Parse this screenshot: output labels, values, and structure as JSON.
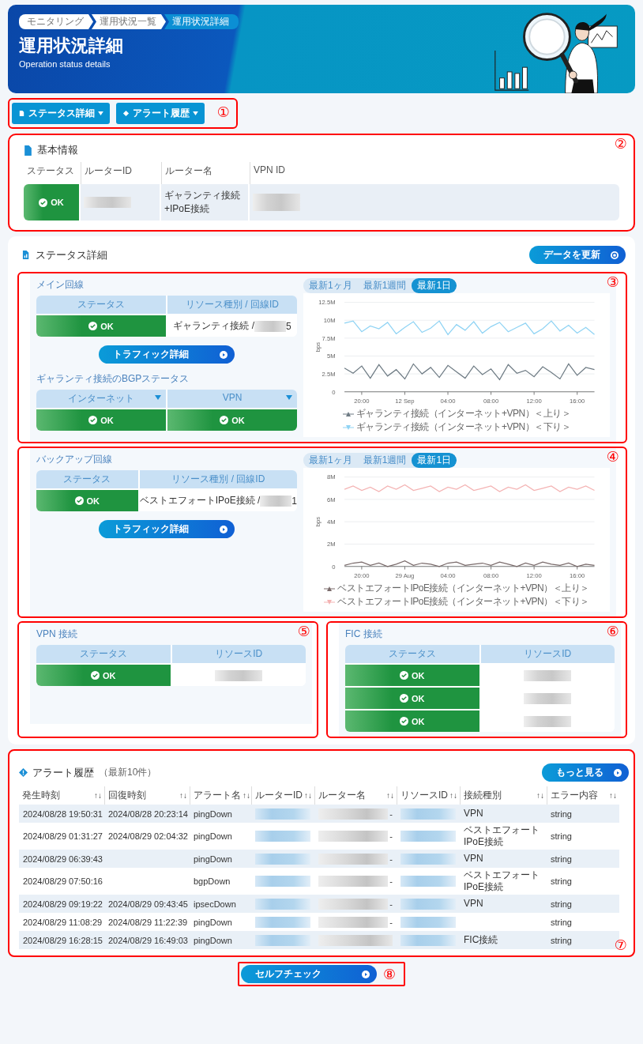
{
  "breadcrumb": [
    {
      "label": "モニタリング",
      "selected": false
    },
    {
      "label": "運用状況一覧",
      "selected": false
    },
    {
      "label": "運用状況詳細",
      "selected": true
    }
  ],
  "title": "運用状況詳細",
  "subtitle": "Operation status details",
  "nav": {
    "marker": "①",
    "buttons": [
      "ステータス詳細",
      "アラート履歴"
    ]
  },
  "basic_info": {
    "marker": "②",
    "title": "基本情報",
    "columns": [
      "ステータス",
      "ルーターID",
      "ルーター名",
      "VPN ID"
    ],
    "status": "OK",
    "router_name": "ギャランティ接続\n+IPoE接続"
  },
  "status_detail": {
    "title": "ステータス詳細",
    "refresh_button": "データを更新",
    "lines": [
      {
        "marker": "③",
        "title": "メイン回線",
        "columns": [
          "ステータス",
          "リソース種別 / 回線ID"
        ],
        "status": "OK",
        "resource_prefix": "ギャランティ接続 /",
        "resource_suffix": "5",
        "traffic_button": "トラフィック詳細",
        "bgp": {
          "title": "ギャランティ接続のBGPステータス",
          "items": [
            {
              "label": "インターネット",
              "status": "OK"
            },
            {
              "label": "VPN",
              "status": "OK"
            }
          ]
        },
        "tabs": [
          {
            "label": "最新1ヶ月",
            "selected": false
          },
          {
            "label": "最新1週間",
            "selected": false
          },
          {
            "label": "最新1日",
            "selected": true
          }
        ],
        "chart_data": {
          "type": "line",
          "ylabel": "bps",
          "grid": true,
          "legend": "bottom",
          "categories": [
            null,
            null,
            "20:00",
            null,
            null,
            null,
            null,
            "12 Sep",
            null,
            null,
            null,
            null,
            "04:00",
            null,
            null,
            null,
            null,
            "08:00",
            null,
            null,
            null,
            null,
            "12:00",
            null,
            null,
            null,
            null,
            "16:00",
            null,
            null
          ],
          "ylim": [
            0,
            12.5
          ],
          "yticks": [
            {
              "value": 0,
              "label": "0"
            },
            {
              "value": 2.5,
              "label": "2.5M"
            },
            {
              "value": 5,
              "label": "5M"
            },
            {
              "value": 7.5,
              "label": "7.5M"
            },
            {
              "value": 10,
              "label": "10M"
            },
            {
              "value": 12.5,
              "label": "12.5M"
            }
          ],
          "series": [
            {
              "name": "ギャランティ接続（インターネット+VPN）＜上り＞",
              "color": "#6e7b84",
              "values": [
                3.3,
                2.6,
                3.6,
                1.9,
                3.8,
                2.2,
                3.1,
                1.8,
                3.9,
                2.5,
                3.4,
                2.0,
                3.7,
                2.8,
                1.9,
                3.6,
                2.4,
                3.2,
                1.7,
                3.8,
                2.6,
                3.0,
                2.1,
                3.5,
                2.7,
                1.8,
                3.9,
                2.3,
                3.4,
                3.1
              ]
            },
            {
              "name": "ギャランティ接続（インターネット+VPN）＜下り＞",
              "color": "#8fd3f4",
              "values": [
                9.6,
                9.9,
                8.4,
                9.2,
                8.8,
                9.7,
                8.1,
                9.0,
                9.8,
                8.3,
                8.9,
                9.9,
                8.0,
                9.4,
                8.6,
                9.8,
                8.2,
                9.1,
                9.7,
                8.4,
                9.0,
                9.6,
                8.1,
                8.8,
                9.9,
                8.5,
                9.3,
                8.2,
                9.0,
                8.0
              ]
            }
          ]
        }
      },
      {
        "marker": "④",
        "title": "バックアップ回線",
        "columns": [
          "ステータス",
          "リソース種別 / 回線ID"
        ],
        "status": "OK",
        "resource_prefix": "ベストエフォートIPoE接続 /",
        "resource_suffix": "1",
        "traffic_button": "トラフィック詳細",
        "tabs": [
          {
            "label": "最新1ヶ月",
            "selected": false
          },
          {
            "label": "最新1週間",
            "selected": false
          },
          {
            "label": "最新1日",
            "selected": true
          }
        ],
        "chart_data": {
          "type": "line",
          "ylabel": "bps",
          "grid": true,
          "legend": "bottom",
          "categories": [
            null,
            null,
            "20:00",
            null,
            null,
            null,
            null,
            "29 Aug",
            null,
            null,
            null,
            null,
            "04:00",
            null,
            null,
            null,
            null,
            "08:00",
            null,
            null,
            null,
            null,
            "12:00",
            null,
            null,
            null,
            null,
            "16:00",
            null,
            null
          ],
          "ylim": [
            0,
            8
          ],
          "yticks": [
            {
              "value": 0,
              "label": "0"
            },
            {
              "value": 2,
              "label": "2M"
            },
            {
              "value": 4,
              "label": "4M"
            },
            {
              "value": 6,
              "label": "6M"
            },
            {
              "value": 8,
              "label": "8M"
            }
          ],
          "series": [
            {
              "name": "ベストエフォートIPoE接続（インターネット+VPN）＜上り＞",
              "color": "#7a6b6b",
              "values": [
                0.1,
                0.3,
                0.4,
                0.1,
                0.3,
                0.0,
                0.2,
                0.5,
                0.1,
                0.3,
                0.2,
                0.0,
                0.3,
                0.4,
                0.1,
                0.2,
                0.3,
                0.1,
                0.4,
                0.2,
                0.0,
                0.3,
                0.1,
                0.4,
                0.2,
                0.1,
                0.3,
                0.0,
                0.2,
                0.1
              ]
            },
            {
              "name": "ベストエフォートIPoE接続（インターネット+VPN）＜下り＞",
              "color": "#f4b3b3",
              "values": [
                6.9,
                7.2,
                6.8,
                7.1,
                6.7,
                7.2,
                6.9,
                7.3,
                6.8,
                7.0,
                7.2,
                6.7,
                7.1,
                6.9,
                7.3,
                6.8,
                7.0,
                7.2,
                6.7,
                7.1,
                6.9,
                7.3,
                6.8,
                7.0,
                7.2,
                6.7,
                7.1,
                6.9,
                7.2,
                6.8
              ]
            }
          ]
        }
      }
    ],
    "vpn": {
      "marker": "⑤",
      "title": "VPN 接続",
      "columns": [
        "ステータス",
        "リソースID"
      ],
      "rows": [
        {
          "status": "OK"
        }
      ]
    },
    "fic": {
      "marker": "⑥",
      "title": "FIC 接続",
      "columns": [
        "ステータス",
        "リソースID"
      ],
      "rows": [
        {
          "status": "OK"
        },
        {
          "status": "OK"
        },
        {
          "status": "OK"
        }
      ]
    }
  },
  "alerts": {
    "marker": "⑦",
    "title": "アラート履歴",
    "note": "（最新10件）",
    "more_button": "もっと見る",
    "columns": [
      {
        "label": "発生時刻",
        "sort": "↑↓"
      },
      {
        "label": "回復時刻",
        "sort": "↑↓"
      },
      {
        "label": "アラート名",
        "sort": "↑↓"
      },
      {
        "label": "ルーターID",
        "sort": "↑↓"
      },
      {
        "label": "ルーター名",
        "sort": "↑↓"
      },
      {
        "label": "リソースID",
        "sort": "↑↓"
      },
      {
        "label": "接続種別",
        "sort": "↑↓"
      },
      {
        "label": "エラー内容",
        "sort": "↑↓"
      }
    ],
    "rows": [
      {
        "occurred": "2024/08/28 19:50:31",
        "recovered": "2024/08/28 20:23:14",
        "alert": "pingDown",
        "router_name_tail": "-",
        "type": "VPN",
        "error": "string"
      },
      {
        "occurred": "2024/08/29 01:31:27",
        "recovered": "2024/08/29 02:04:32",
        "alert": "pingDown",
        "router_name_tail": "-",
        "type": "ベストエフォート\nIPoE接続",
        "error": "string"
      },
      {
        "occurred": "2024/08/29 06:39:43",
        "alert": "pingDown",
        "router_name_tail": "-",
        "type": "VPN",
        "error": "string"
      },
      {
        "occurred": "2024/08/29 07:50:16",
        "alert": "bgpDown",
        "router_name_tail": "-",
        "type": "ベストエフォート\nIPoE接続",
        "error": "string"
      },
      {
        "occurred": "2024/08/29 09:19:22",
        "recovered": "2024/08/29 09:43:45",
        "alert": "ipsecDown",
        "router_name_tail": "-",
        "type": "VPN",
        "error": "string"
      },
      {
        "occurred": "2024/08/29 11:08:29",
        "recovered": "2024/08/29 11:22:39",
        "alert": "pingDown",
        "router_name_tail": "-",
        "error": "string"
      },
      {
        "occurred": "2024/08/29 16:28:15",
        "recovered": "2024/08/29 16:49:03",
        "alert": "pingDown",
        "type": "FIC接続",
        "error": "string"
      }
    ]
  },
  "self_check": {
    "marker": "⑧",
    "label": "セルフチェック"
  }
}
